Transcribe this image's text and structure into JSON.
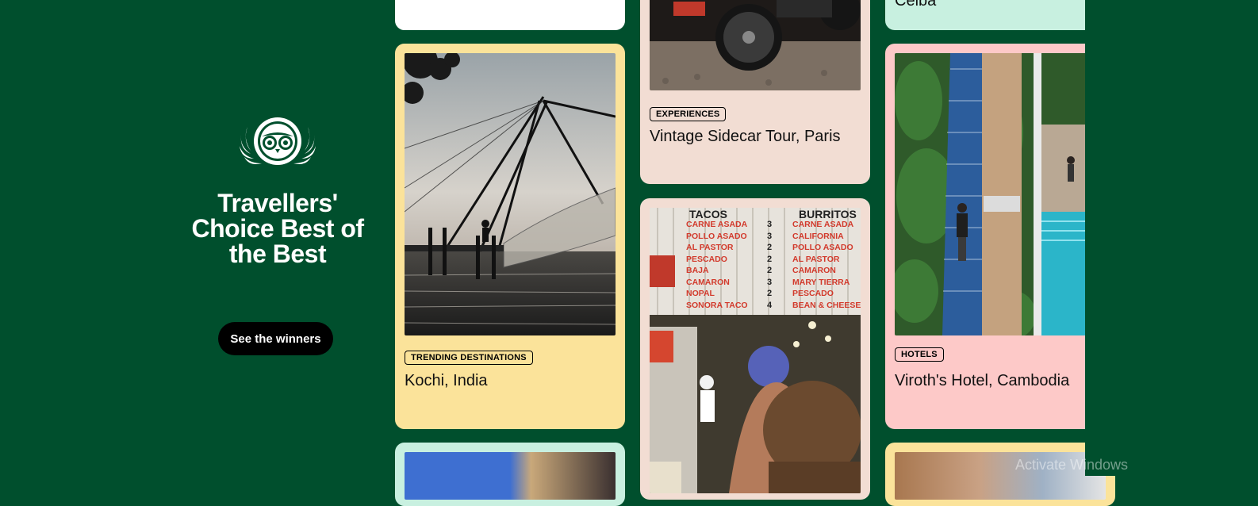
{
  "hero": {
    "title": "Travellers' Choice Best of the Best",
    "button_label": "See the winners"
  },
  "cards": {
    "top_left_blank": {},
    "kochi": {
      "tag": "TRENDING DESTINATIONS",
      "title": "Kochi, India",
      "bg": "#fbe39a"
    },
    "sidecar": {
      "tag": "EXPERIENCES",
      "title": "Vintage Sidecar Tour, Paris",
      "bg": "#f2ddd3"
    },
    "tacos": {
      "bg": "#f2ddd3"
    },
    "ceiba": {
      "title": "Ceiba",
      "bg": "#c8f0e0"
    },
    "viroth": {
      "tag": "HOTELS",
      "title": "Viroth's Hotel, Cambodia",
      "bg": "#fdc9c8"
    },
    "bottom_left": {
      "bg": "#c8f0e0"
    },
    "bottom_right": {
      "bg": "#fbe39a"
    }
  },
  "menu_board": {
    "left_items": [
      "CARNE ASADA",
      "POLLO ASADO",
      "AL PASTOR",
      "PESCADO",
      "BAJA",
      "CAMARON",
      "NOPAL",
      "SONORA TACO"
    ],
    "left_prices": [
      "3",
      "3",
      "2",
      "2",
      "2",
      "3",
      "2",
      "4"
    ],
    "right_items": [
      "CARNE ASADA",
      "CALIFORNIA",
      "POLLO ASADO",
      "AL PASTOR",
      "CAMARON",
      "MARY TIERRA",
      "PESCADO",
      "BEAN & CHEESE"
    ],
    "headers": [
      "TACOS",
      "BURRITOS"
    ]
  },
  "system": {
    "watermark": "Activate Windows"
  },
  "colors": {
    "brand_green": "#004f2d",
    "black": "#000000"
  }
}
